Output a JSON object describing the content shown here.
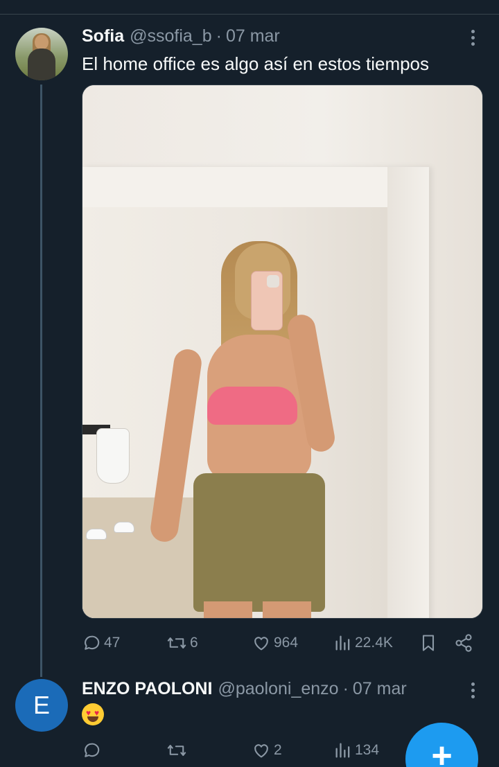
{
  "tweet": {
    "author_name": "Sofia",
    "author_handle": "@ssofia_b",
    "separator": "·",
    "date": "07 mar",
    "text": "El home office es algo así en estos tiempos",
    "stats": {
      "replies": "47",
      "retweets": "6",
      "likes": "964",
      "views": "22.4K"
    }
  },
  "reply": {
    "avatar_letter": "E",
    "author_name": "ENZO PAOLONI",
    "author_handle": "@paoloni_enzo",
    "separator": "·",
    "date": "07 mar",
    "emoji": "heart-eyes-emoji",
    "stats": {
      "replies": "",
      "retweets": "",
      "likes": "2",
      "views": "134"
    }
  },
  "fab": {
    "label": "+"
  },
  "colors": {
    "background": "#15202b",
    "text_primary": "#f7f9f9",
    "text_secondary": "#8b98a5",
    "accent": "#1d9bf0",
    "reply_avatar": "#1b6bb8"
  },
  "icons": {
    "reply": "reply-icon",
    "retweet": "retweet-icon",
    "like": "heart-icon",
    "views": "views-icon",
    "bookmark": "bookmark-icon",
    "share": "share-icon",
    "more": "more-dots-icon",
    "compose": "plus-icon"
  }
}
